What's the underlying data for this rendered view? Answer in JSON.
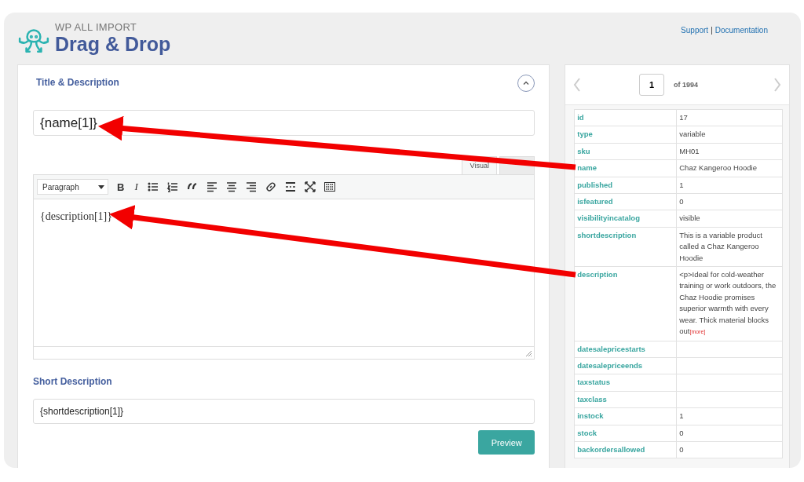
{
  "header": {
    "brand_top": "WP ALL IMPORT",
    "brand_title": "Drag & Drop",
    "links": [
      {
        "label": "Support"
      },
      {
        "label": "Documentation"
      }
    ],
    "separator": "|"
  },
  "editor_panel": {
    "heading": "Title & Description",
    "expanded": true,
    "title_value": "{name[1]}",
    "tabs": [
      {
        "label": "Visual",
        "selected": true
      },
      {
        "selected": false
      }
    ],
    "format_select": "Paragraph",
    "toolbar": [
      {
        "kind": "bold",
        "glyph": "B"
      },
      {
        "kind": "italic",
        "glyph": "I"
      },
      {
        "kind": "bullets"
      },
      {
        "kind": "numbers"
      },
      {
        "kind": "quote"
      },
      {
        "kind": "align-left"
      },
      {
        "kind": "align-center"
      },
      {
        "kind": "align-right"
      },
      {
        "kind": "link"
      },
      {
        "kind": "more"
      },
      {
        "kind": "fullscreen"
      },
      {
        "kind": "toolbar-toggle"
      }
    ],
    "content": "{description[1]}",
    "short_heading": "Short Description",
    "short_value": "{shortdescription[1]}",
    "preview_button": "Preview"
  },
  "record_panel": {
    "page": "1",
    "of_total": "of 1994",
    "rows": [
      {
        "key": "id",
        "value": "17"
      },
      {
        "key": "type",
        "value": "variable"
      },
      {
        "key": "sku",
        "value": "MH01"
      },
      {
        "key": "name",
        "value": "Chaz Kangeroo Hoodie"
      },
      {
        "key": "published",
        "value": "1"
      },
      {
        "key": "isfeatured",
        "value": "0"
      },
      {
        "key": "visibilityincatalog",
        "value": "visible"
      },
      {
        "key": "shortdescription",
        "value": "This is a variable product called a Chaz Kangeroo Hoodie"
      },
      {
        "key": "description",
        "value": "<p>Ideal for cold-weather training or work outdoors, the Chaz Hoodie promises superior warmth with every wear. Thick material blocks out",
        "more_link": "[more]"
      },
      {
        "key": "datesalepricestarts"
      },
      {
        "key": "datesalepriceends"
      },
      {
        "key": "taxstatus"
      },
      {
        "key": "taxclass"
      },
      {
        "key": "instock",
        "value": "1"
      },
      {
        "key": "stock",
        "value": "0"
      },
      {
        "key": "backordersallowed",
        "value": "0"
      }
    ]
  },
  "annotations": [
    {
      "kind": "arrow"
    },
    {
      "kind": "arrow"
    }
  ]
}
